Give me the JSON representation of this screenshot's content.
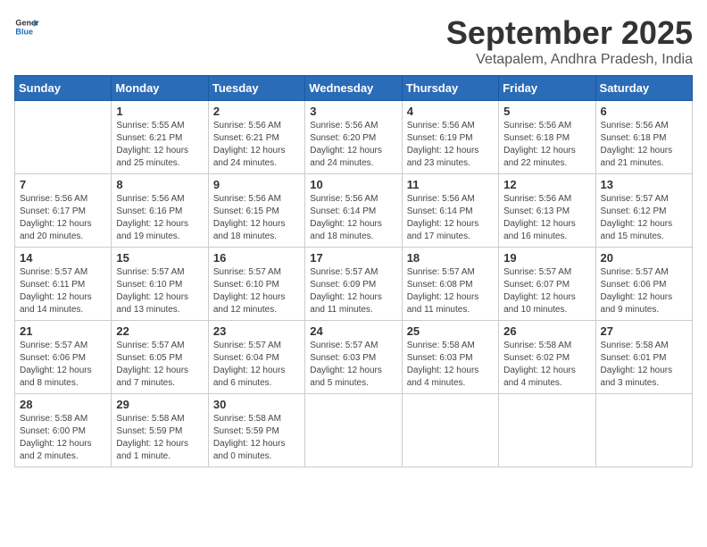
{
  "logo": {
    "general": "General",
    "blue": "Blue"
  },
  "title": "September 2025",
  "location": "Vetapalem, Andhra Pradesh, India",
  "days": [
    "Sunday",
    "Monday",
    "Tuesday",
    "Wednesday",
    "Thursday",
    "Friday",
    "Saturday"
  ],
  "weeks": [
    [
      {
        "date": "",
        "sunrise": "",
        "sunset": "",
        "daylight": ""
      },
      {
        "date": "1",
        "sunrise": "Sunrise: 5:55 AM",
        "sunset": "Sunset: 6:21 PM",
        "daylight": "Daylight: 12 hours and 25 minutes."
      },
      {
        "date": "2",
        "sunrise": "Sunrise: 5:56 AM",
        "sunset": "Sunset: 6:21 PM",
        "daylight": "Daylight: 12 hours and 24 minutes."
      },
      {
        "date": "3",
        "sunrise": "Sunrise: 5:56 AM",
        "sunset": "Sunset: 6:20 PM",
        "daylight": "Daylight: 12 hours and 24 minutes."
      },
      {
        "date": "4",
        "sunrise": "Sunrise: 5:56 AM",
        "sunset": "Sunset: 6:19 PM",
        "daylight": "Daylight: 12 hours and 23 minutes."
      },
      {
        "date": "5",
        "sunrise": "Sunrise: 5:56 AM",
        "sunset": "Sunset: 6:18 PM",
        "daylight": "Daylight: 12 hours and 22 minutes."
      },
      {
        "date": "6",
        "sunrise": "Sunrise: 5:56 AM",
        "sunset": "Sunset: 6:18 PM",
        "daylight": "Daylight: 12 hours and 21 minutes."
      }
    ],
    [
      {
        "date": "7",
        "sunrise": "Sunrise: 5:56 AM",
        "sunset": "Sunset: 6:17 PM",
        "daylight": "Daylight: 12 hours and 20 minutes."
      },
      {
        "date": "8",
        "sunrise": "Sunrise: 5:56 AM",
        "sunset": "Sunset: 6:16 PM",
        "daylight": "Daylight: 12 hours and 19 minutes."
      },
      {
        "date": "9",
        "sunrise": "Sunrise: 5:56 AM",
        "sunset": "Sunset: 6:15 PM",
        "daylight": "Daylight: 12 hours and 18 minutes."
      },
      {
        "date": "10",
        "sunrise": "Sunrise: 5:56 AM",
        "sunset": "Sunset: 6:14 PM",
        "daylight": "Daylight: 12 hours and 18 minutes."
      },
      {
        "date": "11",
        "sunrise": "Sunrise: 5:56 AM",
        "sunset": "Sunset: 6:14 PM",
        "daylight": "Daylight: 12 hours and 17 minutes."
      },
      {
        "date": "12",
        "sunrise": "Sunrise: 5:56 AM",
        "sunset": "Sunset: 6:13 PM",
        "daylight": "Daylight: 12 hours and 16 minutes."
      },
      {
        "date": "13",
        "sunrise": "Sunrise: 5:57 AM",
        "sunset": "Sunset: 6:12 PM",
        "daylight": "Daylight: 12 hours and 15 minutes."
      }
    ],
    [
      {
        "date": "14",
        "sunrise": "Sunrise: 5:57 AM",
        "sunset": "Sunset: 6:11 PM",
        "daylight": "Daylight: 12 hours and 14 minutes."
      },
      {
        "date": "15",
        "sunrise": "Sunrise: 5:57 AM",
        "sunset": "Sunset: 6:10 PM",
        "daylight": "Daylight: 12 hours and 13 minutes."
      },
      {
        "date": "16",
        "sunrise": "Sunrise: 5:57 AM",
        "sunset": "Sunset: 6:10 PM",
        "daylight": "Daylight: 12 hours and 12 minutes."
      },
      {
        "date": "17",
        "sunrise": "Sunrise: 5:57 AM",
        "sunset": "Sunset: 6:09 PM",
        "daylight": "Daylight: 12 hours and 11 minutes."
      },
      {
        "date": "18",
        "sunrise": "Sunrise: 5:57 AM",
        "sunset": "Sunset: 6:08 PM",
        "daylight": "Daylight: 12 hours and 11 minutes."
      },
      {
        "date": "19",
        "sunrise": "Sunrise: 5:57 AM",
        "sunset": "Sunset: 6:07 PM",
        "daylight": "Daylight: 12 hours and 10 minutes."
      },
      {
        "date": "20",
        "sunrise": "Sunrise: 5:57 AM",
        "sunset": "Sunset: 6:06 PM",
        "daylight": "Daylight: 12 hours and 9 minutes."
      }
    ],
    [
      {
        "date": "21",
        "sunrise": "Sunrise: 5:57 AM",
        "sunset": "Sunset: 6:06 PM",
        "daylight": "Daylight: 12 hours and 8 minutes."
      },
      {
        "date": "22",
        "sunrise": "Sunrise: 5:57 AM",
        "sunset": "Sunset: 6:05 PM",
        "daylight": "Daylight: 12 hours and 7 minutes."
      },
      {
        "date": "23",
        "sunrise": "Sunrise: 5:57 AM",
        "sunset": "Sunset: 6:04 PM",
        "daylight": "Daylight: 12 hours and 6 minutes."
      },
      {
        "date": "24",
        "sunrise": "Sunrise: 5:57 AM",
        "sunset": "Sunset: 6:03 PM",
        "daylight": "Daylight: 12 hours and 5 minutes."
      },
      {
        "date": "25",
        "sunrise": "Sunrise: 5:58 AM",
        "sunset": "Sunset: 6:03 PM",
        "daylight": "Daylight: 12 hours and 4 minutes."
      },
      {
        "date": "26",
        "sunrise": "Sunrise: 5:58 AM",
        "sunset": "Sunset: 6:02 PM",
        "daylight": "Daylight: 12 hours and 4 minutes."
      },
      {
        "date": "27",
        "sunrise": "Sunrise: 5:58 AM",
        "sunset": "Sunset: 6:01 PM",
        "daylight": "Daylight: 12 hours and 3 minutes."
      }
    ],
    [
      {
        "date": "28",
        "sunrise": "Sunrise: 5:58 AM",
        "sunset": "Sunset: 6:00 PM",
        "daylight": "Daylight: 12 hours and 2 minutes."
      },
      {
        "date": "29",
        "sunrise": "Sunrise: 5:58 AM",
        "sunset": "Sunset: 5:59 PM",
        "daylight": "Daylight: 12 hours and 1 minute."
      },
      {
        "date": "30",
        "sunrise": "Sunrise: 5:58 AM",
        "sunset": "Sunset: 5:59 PM",
        "daylight": "Daylight: 12 hours and 0 minutes."
      },
      {
        "date": "",
        "sunrise": "",
        "sunset": "",
        "daylight": ""
      },
      {
        "date": "",
        "sunrise": "",
        "sunset": "",
        "daylight": ""
      },
      {
        "date": "",
        "sunrise": "",
        "sunset": "",
        "daylight": ""
      },
      {
        "date": "",
        "sunrise": "",
        "sunset": "",
        "daylight": ""
      }
    ]
  ]
}
